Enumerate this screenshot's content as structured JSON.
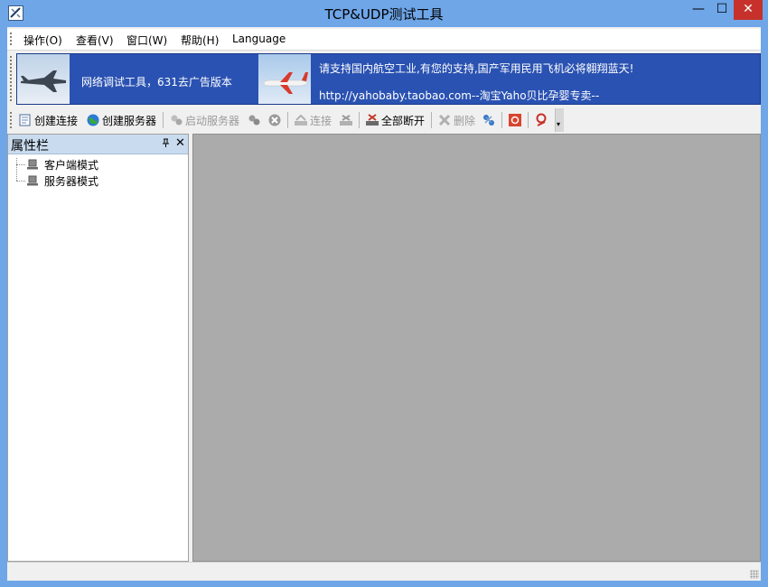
{
  "window": {
    "title": "TCP&UDP测试工具",
    "minimize_glyph": "—",
    "maximize_glyph": "☐",
    "close_glyph": "✕"
  },
  "menu": {
    "items": [
      {
        "label": "操作(O)"
      },
      {
        "label": "查看(V)"
      },
      {
        "label": "窗口(W)"
      },
      {
        "label": "帮助(H)"
      },
      {
        "label": "Language"
      }
    ]
  },
  "banner": {
    "text_left": "网络调试工具，631去广告版本",
    "text_right_line1": "请支持国内航空工业,有您的支持,国产军用民用飞机必将翱翔蓝天!",
    "text_right_line2": "http://yahobaby.taobao.com--淘宝Yaho贝比孕婴专卖--"
  },
  "toolbar": {
    "create_connection": "创建连接",
    "create_server": "创建服务器",
    "start_server": "启动服务器",
    "connect": "连接",
    "disconnect_all": "全部断开",
    "delete": "删除",
    "overflow_glyph": "▾"
  },
  "panel": {
    "title": "属性栏",
    "pin_glyph": "📌",
    "close_glyph": "✕",
    "tree": [
      {
        "label": "客户端模式"
      },
      {
        "label": "服务器模式"
      }
    ]
  },
  "icons": {
    "app": "tools-icon",
    "create_connection": "new-connection-icon",
    "create_server": "globe-icon",
    "start_server": "server-start-icon",
    "stop_server": "server-stop-icon",
    "stop": "stop-circle-icon",
    "connect": "connect-icon",
    "disconnect": "disconnect-icon",
    "disconnect_all": "disconnect-all-icon",
    "delete": "delete-icon",
    "settings": "network-settings-icon",
    "exit": "exit-icon",
    "help": "help-icon"
  },
  "colors": {
    "title_bar": "#6ea6e8",
    "banner_bg": "#2a52b2",
    "close_button": "#c7312b",
    "mdi_bg": "#ababab",
    "panel_header": "#c9dbee"
  }
}
